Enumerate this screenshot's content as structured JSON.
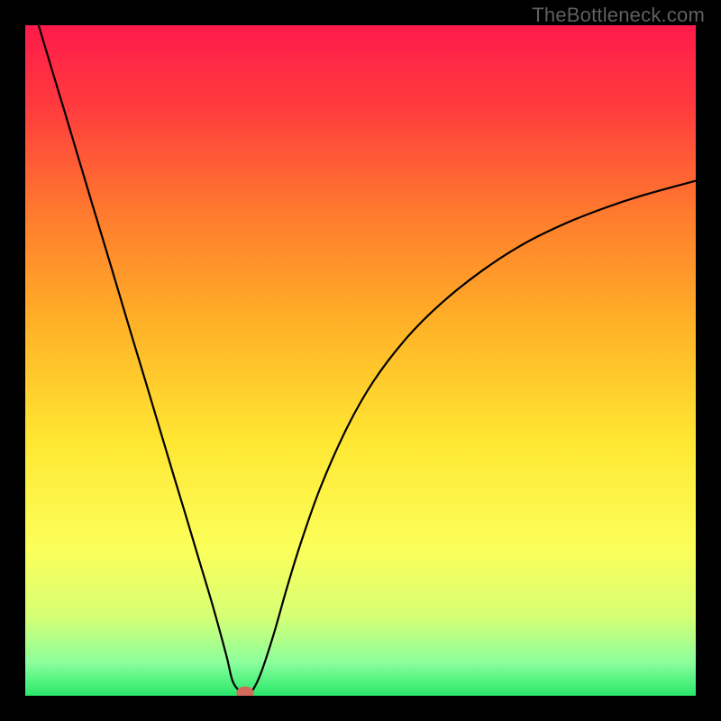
{
  "watermark": "TheBottleneck.com",
  "chart_data": {
    "type": "line",
    "title": "",
    "xlabel": "",
    "ylabel": "",
    "xlim": [
      0,
      100
    ],
    "ylim": [
      0,
      100
    ],
    "background_gradient": {
      "stops": [
        {
          "offset": 0.0,
          "color": "#ff1a4b"
        },
        {
          "offset": 0.12,
          "color": "#ff3b3e"
        },
        {
          "offset": 0.28,
          "color": "#ff7a2e"
        },
        {
          "offset": 0.45,
          "color": "#ffb327"
        },
        {
          "offset": 0.62,
          "color": "#ffe733"
        },
        {
          "offset": 0.78,
          "color": "#fcff5a"
        },
        {
          "offset": 0.88,
          "color": "#d7ff74"
        },
        {
          "offset": 0.95,
          "color": "#8cff9c"
        },
        {
          "offset": 1.0,
          "color": "#28e76a"
        }
      ]
    },
    "series": [
      {
        "name": "bottleneck-curve",
        "color": "#000000",
        "width": 2.2,
        "x": [
          2,
          4,
          6,
          8,
          10,
          12,
          14,
          16,
          18,
          20,
          22,
          24,
          26,
          28,
          30,
          31,
          32.5,
          33.5,
          35,
          37,
          39,
          41,
          44,
          48,
          52,
          57,
          62,
          68,
          74,
          80,
          86,
          92,
          100
        ],
        "y": [
          100,
          93.3,
          86.7,
          80.0,
          73.3,
          66.7,
          60.0,
          53.3,
          46.7,
          40.0,
          33.3,
          26.7,
          20.0,
          13.3,
          6.0,
          2.0,
          0.3,
          0.3,
          3.0,
          9.0,
          16.0,
          22.5,
          31.0,
          40.0,
          47.0,
          53.5,
          58.5,
          63.3,
          67.2,
          70.2,
          72.6,
          74.6,
          76.8
        ]
      }
    ],
    "marker": {
      "x": 32.8,
      "y": 0.4,
      "rx": 1.3,
      "ry": 1.0,
      "color": "#d46a5a"
    }
  }
}
